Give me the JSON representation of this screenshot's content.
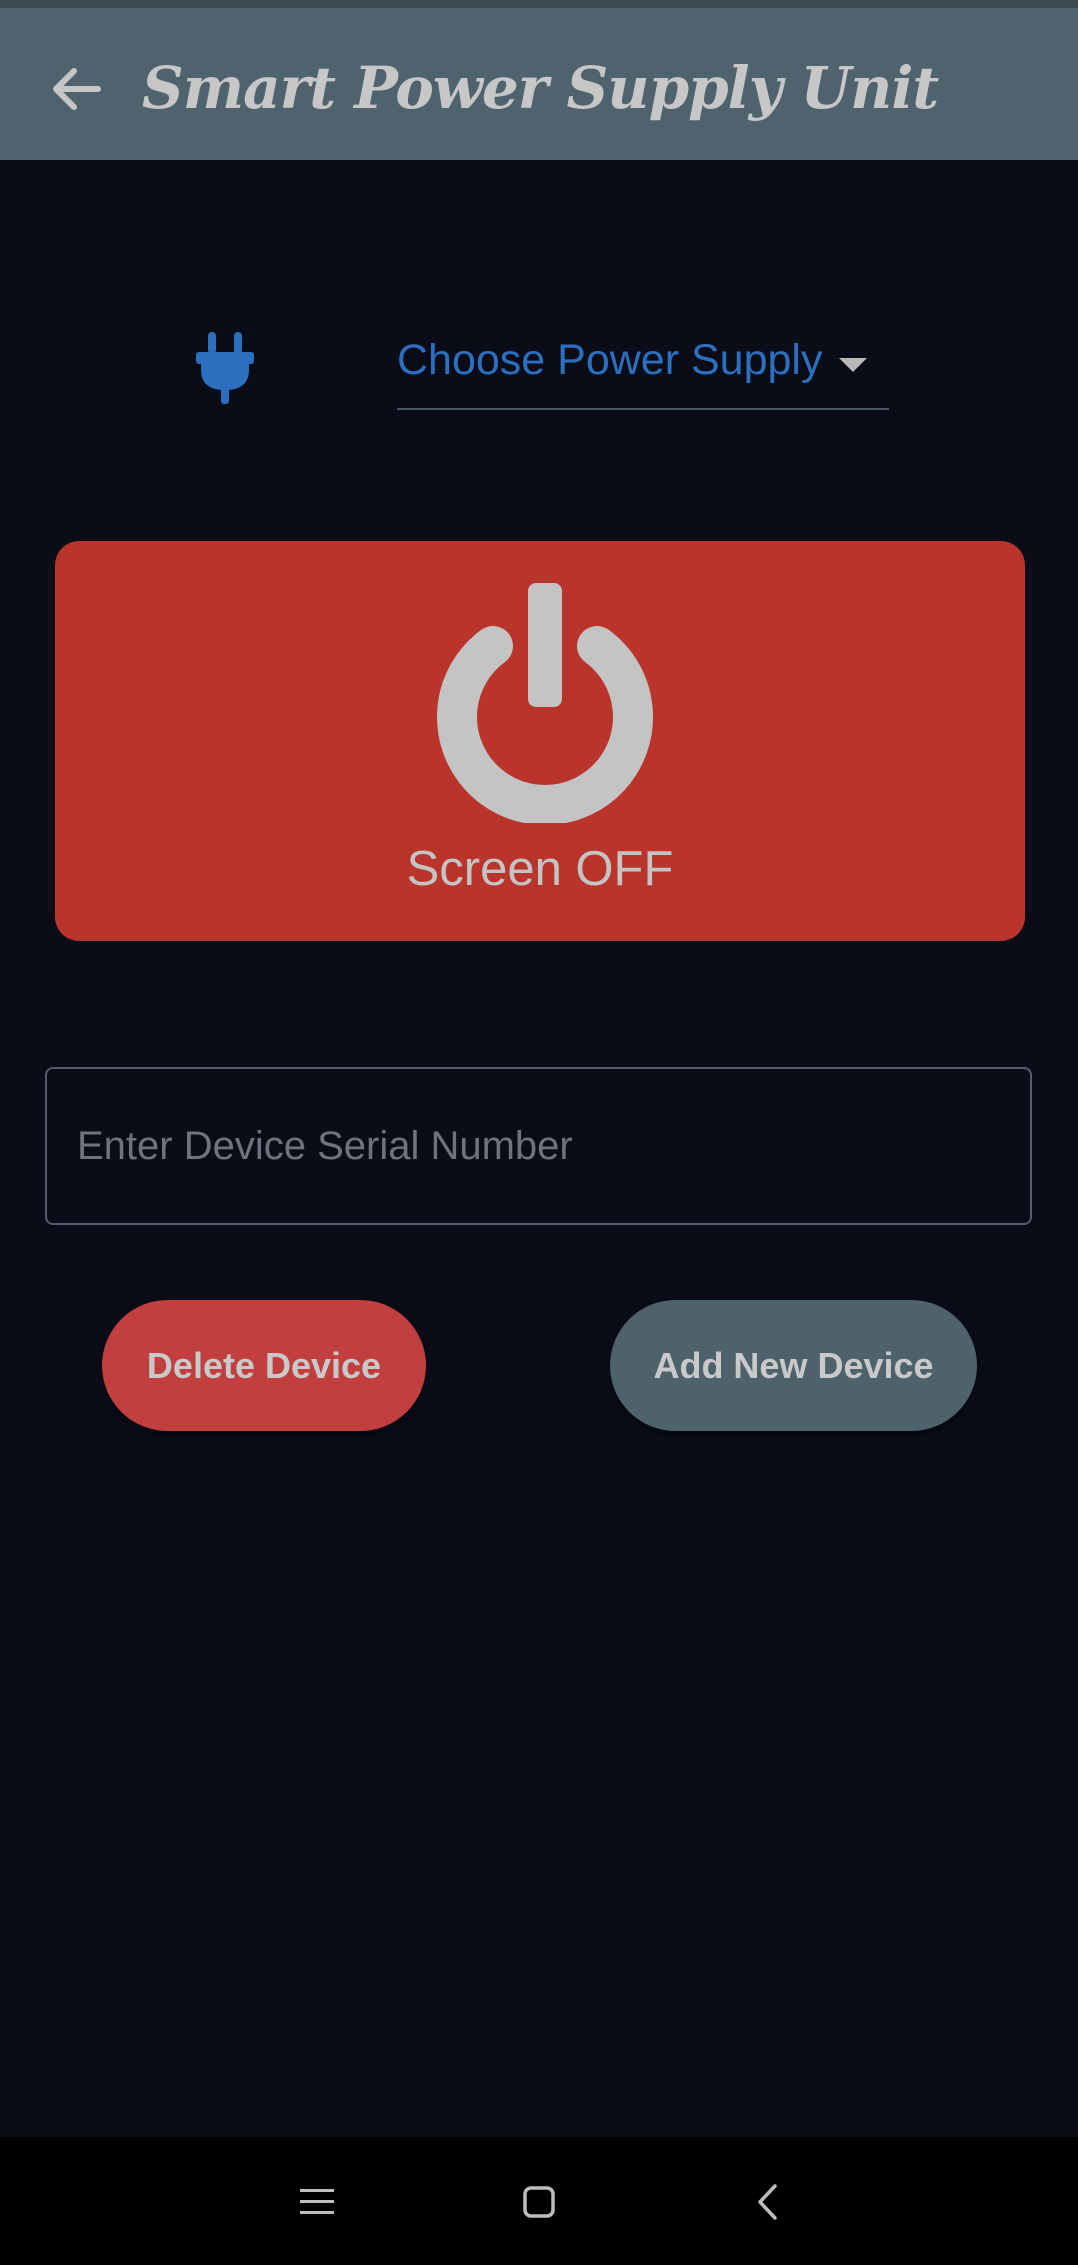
{
  "app_bar": {
    "title": "Smart Power Supply Unit",
    "back_icon": "arrow-left-icon"
  },
  "power_supply_selector": {
    "icon": "plug-icon",
    "label": "Choose Power Supply",
    "arrow_icon": "caret-down-icon"
  },
  "power_toggle": {
    "icon": "power-icon",
    "label": "Screen OFF",
    "state": "off"
  },
  "serial_field": {
    "placeholder": "Enter Device Serial Number",
    "value": ""
  },
  "actions": {
    "delete_label": "Delete Device",
    "add_label": "Add New Device"
  },
  "system_nav": {
    "recents_icon": "menu-icon",
    "home_icon": "square-icon",
    "back_icon": "chevron-left-icon"
  },
  "colors": {
    "background": "#0a0c18",
    "app_bar": "#4e636d",
    "accent_blue": "#2c6fbf",
    "power_off_red": "#b9342b",
    "delete_red": "#c13f3e",
    "add_gray": "#4e626c",
    "text_light": "#c4c4c4"
  }
}
